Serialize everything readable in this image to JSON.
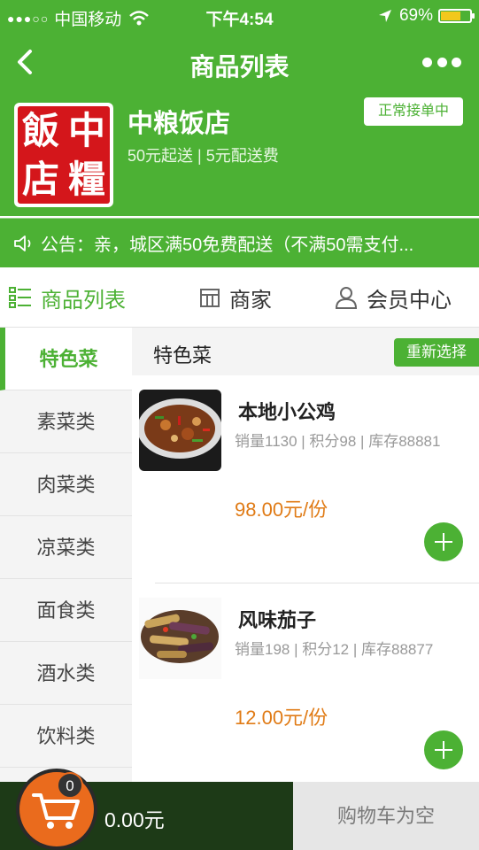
{
  "statusbar": {
    "carrier": "中国移动",
    "time": "下午4:54",
    "battery": "69%",
    "battery_level": 0.69
  },
  "nav": {
    "title": "商品列表"
  },
  "shop": {
    "logo_text": [
      "飯",
      "中",
      "店",
      "糧"
    ],
    "name": "中粮饭店",
    "meta": "50元起送 | 5元配送费",
    "status": "正常接单中"
  },
  "notice": {
    "text": "公告：亲，城区满50免费配送（不满50需支付..."
  },
  "tabs": [
    {
      "label": "商品列表",
      "icon": "list-icon",
      "active": true
    },
    {
      "label": "商家",
      "icon": "store-icon",
      "active": false
    },
    {
      "label": "会员中心",
      "icon": "user-icon",
      "active": false
    }
  ],
  "categories": [
    "特色菜",
    "素菜类",
    "肉菜类",
    "凉菜类",
    "面食类",
    "酒水类",
    "饮料类"
  ],
  "section": {
    "title": "特色菜",
    "reselect": "重新选择"
  },
  "products": [
    {
      "name": "本地小公鸡",
      "meta": "销量1130 | 积分98 | 库存88881",
      "price": "98.00元/份"
    },
    {
      "name": "风味茄子",
      "meta": "销量198 | 积分12 | 库存88877",
      "price": "12.00元/份"
    }
  ],
  "cart": {
    "count": "0",
    "total": "0.00元",
    "empty_text": "购物车为空"
  },
  "colors": {
    "primary": "#4cb134",
    "price": "#e07b16",
    "cart_button": "#ea6b1d",
    "cart_bar": "#1d3a17"
  }
}
